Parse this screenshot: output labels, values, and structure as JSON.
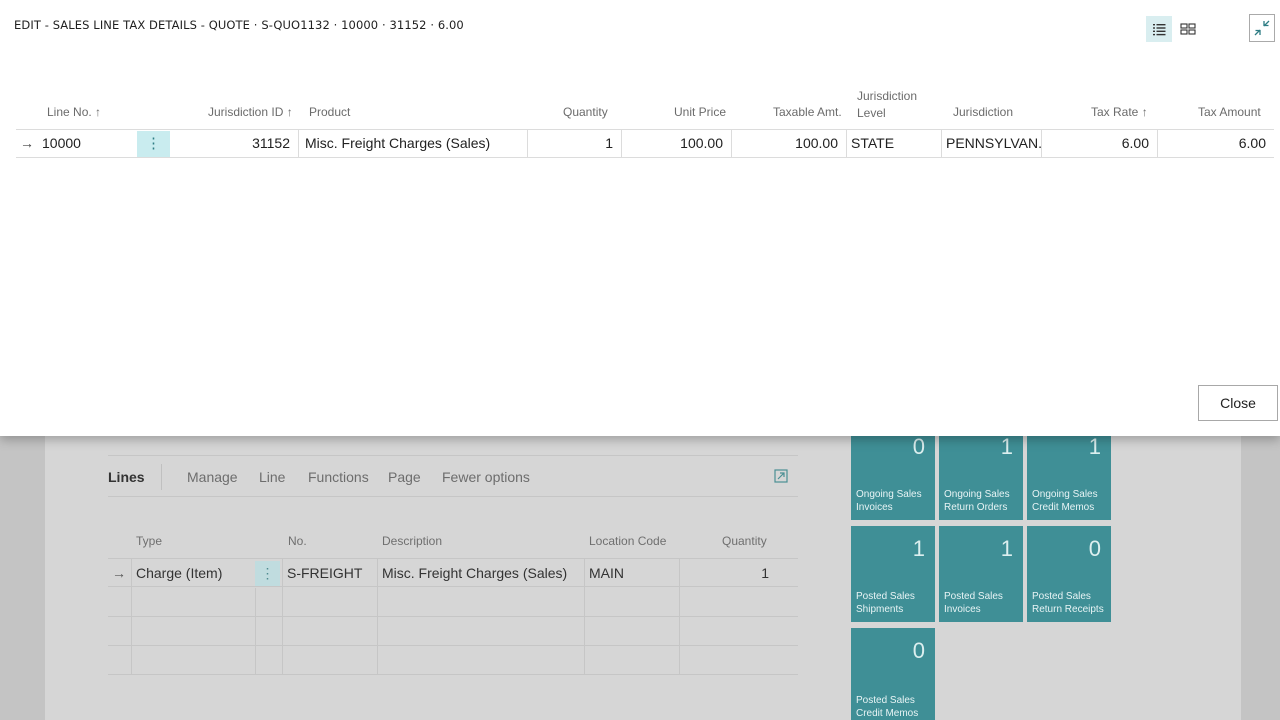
{
  "dialog": {
    "title": "EDIT - SALES LINE TAX DETAILS - QUOTE · S-QUO1132 · 10000 · 31152 · 6.00",
    "close_label": "Close",
    "columns": {
      "line_no": "Line No. ↑",
      "jurisdiction_id": "Jurisdiction ID ↑",
      "product": "Product",
      "quantity": "Quantity",
      "unit_price": "Unit Price",
      "taxable_amt": "Taxable Amt.",
      "jurisdiction_level_1": "Jurisdiction",
      "jurisdiction_level_2": "Level",
      "jurisdiction": "Jurisdiction",
      "tax_rate": "Tax Rate ↑",
      "tax_amount": "Tax Amount"
    },
    "row": {
      "indicator": "→",
      "line_no": "10000",
      "actions": "⋮",
      "jurisdiction_id": "31152",
      "product": "Misc. Freight Charges (Sales)",
      "quantity": "1",
      "unit_price": "100.00",
      "taxable_amt": "100.00",
      "jurisdiction_level": "STATE",
      "jurisdiction": "PENNSYLVAN...",
      "tax_rate": "6.00",
      "tax_amount": "6.00"
    },
    "icons": {
      "list_view": "list-view-icon",
      "tile_view": "tile-view-icon",
      "collapse": "collapse-icon"
    }
  },
  "background": {
    "lines_menu": {
      "lines": "Lines",
      "manage": "Manage",
      "line": "Line",
      "functions": "Functions",
      "page": "Page",
      "fewer": "Fewer options"
    },
    "lines_columns": {
      "type": "Type",
      "no": "No.",
      "description": "Description",
      "location": "Location Code",
      "quantity": "Quantity"
    },
    "lines_row": {
      "indicator": "→",
      "type": "Charge (Item)",
      "actions": "⋮",
      "no": "S-FREIGHT",
      "description": "Misc. Freight Charges (Sales)",
      "location": "MAIN",
      "quantity": "1"
    },
    "cues": [
      {
        "value": "0",
        "label": "Ongoing Sales Invoices"
      },
      {
        "value": "1",
        "label": "Ongoing Sales Return Orders"
      },
      {
        "value": "1",
        "label": "Ongoing Sales Credit Memos"
      },
      {
        "value": "1",
        "label": "Posted Sales Shipments"
      },
      {
        "value": "1",
        "label": "Posted Sales Invoices"
      },
      {
        "value": "0",
        "label": "Posted Sales Return Receipts"
      },
      {
        "value": "0",
        "label": "Posted Sales Credit Memos"
      }
    ]
  },
  "colors": {
    "accent": "#3f8f96",
    "selection": "#c9ecef"
  }
}
